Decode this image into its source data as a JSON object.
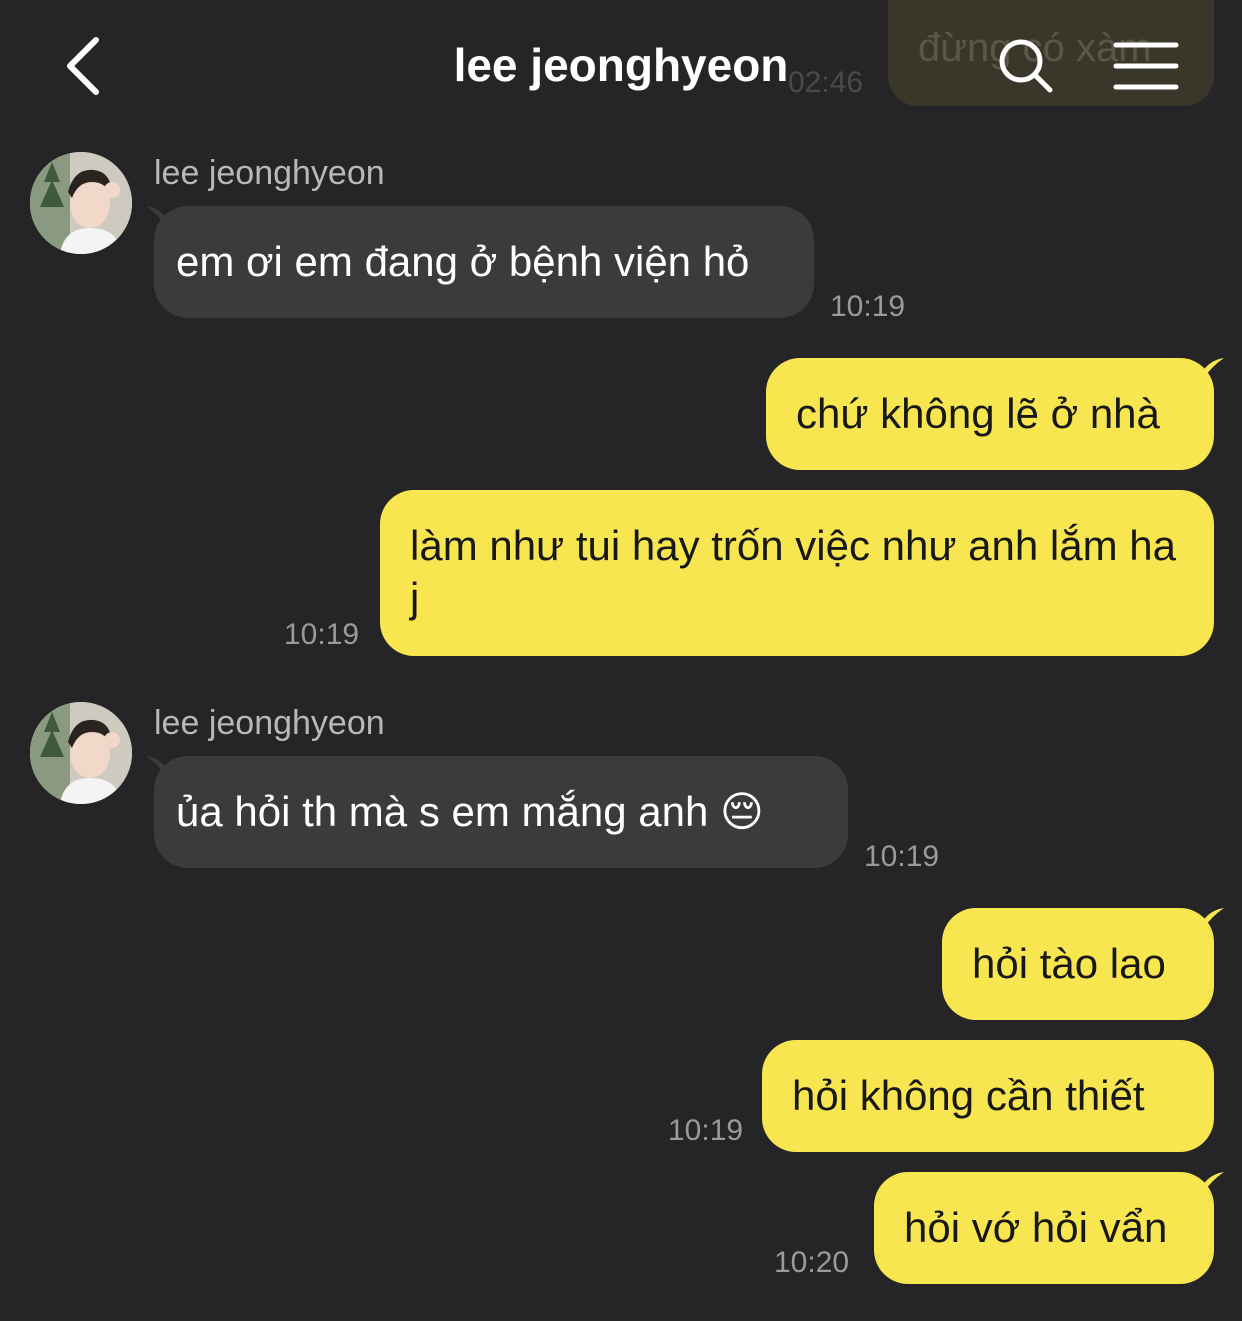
{
  "header": {
    "title": "lee jeonghyeon",
    "back_icon": "chevron-left-icon",
    "search_icon": "search-icon",
    "menu_icon": "hamburger-menu-icon",
    "peek_message": "đừng có xàm",
    "peek_time": "02:46"
  },
  "colors": {
    "background": "#252527",
    "incoming_bubble": "#3b3b3e",
    "outgoing_bubble": "#f8e651",
    "time_text": "#9a9a9c"
  },
  "messages": [
    {
      "sender": "lee jeonghyeon",
      "text": "em ơi em đang ở bệnh viện hỏ",
      "time": "10:19"
    },
    {
      "text": "chứ không lẽ ở nhà"
    },
    {
      "text": "làm như tui hay trốn việc như anh lắm ha j",
      "time": "10:19"
    },
    {
      "sender": "lee jeonghyeon",
      "text": "ủa hỏi th mà s em mắng anh 😔",
      "time": "10:19"
    },
    {
      "text": "hỏi tào lao"
    },
    {
      "text": "hỏi không cần thiết",
      "time": "10:19"
    },
    {
      "text": "hỏi vớ hỏi vẩn",
      "time": "10:20"
    }
  ]
}
